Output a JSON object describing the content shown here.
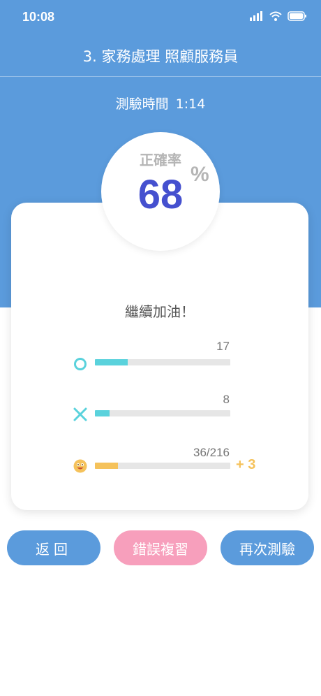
{
  "status_bar": {
    "time": "10:08"
  },
  "header": {
    "title": "3. 家務處理 照顧服務員"
  },
  "timer": {
    "label": "測驗時間",
    "value": "1:14"
  },
  "result": {
    "rate_label": "正確率",
    "rate_value": "68",
    "rate_unit": "%",
    "message": "繼續加油！"
  },
  "stats": {
    "correct": {
      "icon": "circle-icon",
      "count": "17",
      "fraction": 0.24,
      "color": "#5ad2dc"
    },
    "wrong": {
      "icon": "cross-icon",
      "count": "8",
      "fraction": 0.11,
      "color": "#5ad2dc"
    },
    "progress": {
      "icon": "smiley-icon",
      "count": "36/216",
      "fraction": 0.17,
      "bonus": "+ 3",
      "color": "#f5c25b"
    }
  },
  "buttons": {
    "back": "返回",
    "review": "錯誤複習",
    "retry": "再次測驗"
  },
  "colors": {
    "primary": "#5b9bdc",
    "accent_pink": "#f79fbc",
    "rate_blue": "#4550cf"
  }
}
